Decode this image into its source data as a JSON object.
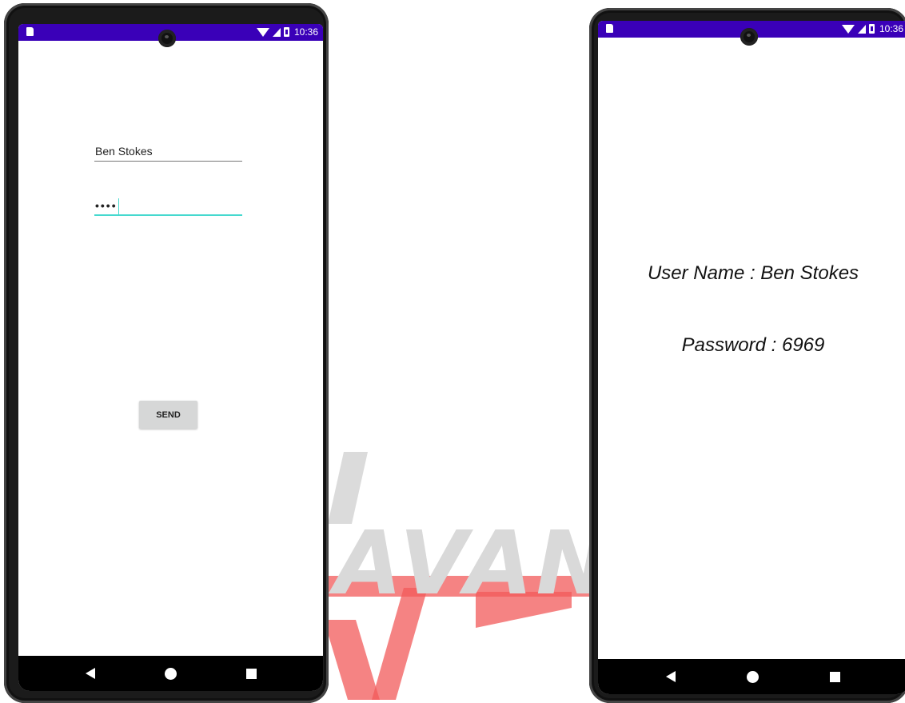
{
  "watermark": {
    "text": "AVANE"
  },
  "left_phone": {
    "status": {
      "time": "10:36"
    },
    "username_field": {
      "value": "Ben Stokes"
    },
    "password_field": {
      "value": "••••"
    },
    "send_button": {
      "label": "SEND"
    }
  },
  "right_phone": {
    "status": {
      "time": "10:36"
    },
    "user_line": "User Name : Ben Stokes",
    "password_line": "Password : 6969"
  },
  "colors": {
    "status_bar": "#3a00b8",
    "accent": "#45d9cf",
    "button_bg": "#d6d7d7"
  }
}
